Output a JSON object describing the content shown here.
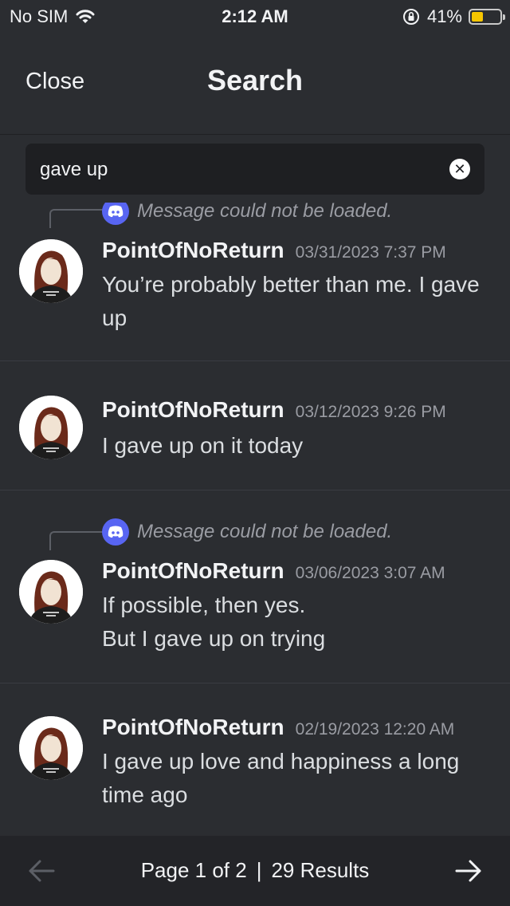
{
  "status_bar": {
    "carrier": "No SIM",
    "time": "2:12 AM",
    "battery_percent": "41%",
    "battery_level": 0.41,
    "icons": [
      "wifi-icon",
      "orientation-lock-icon",
      "battery-icon"
    ]
  },
  "header": {
    "close_label": "Close",
    "title": "Search"
  },
  "search": {
    "value": "gave up"
  },
  "results": [
    {
      "reply_text": "Message could not be loaded.",
      "username": "PointOfNoReturn",
      "timestamp": "03/31/2023 7:37 PM",
      "message": "You’re probably better than me. I gave up"
    },
    {
      "username": "PointOfNoReturn",
      "timestamp": "03/12/2023 9:26 PM",
      "message": "I gave up on it today"
    },
    {
      "reply_text": "Message could not be loaded.",
      "username": "PointOfNoReturn",
      "timestamp": "03/06/2023 3:07 AM",
      "message_lines": [
        "If possible, then yes.",
        "But I gave up on trying"
      ]
    },
    {
      "username": "PointOfNoReturn",
      "timestamp": "02/19/2023 12:20 AM",
      "message": "I gave up love and happiness a long time ago"
    }
  ],
  "footer": {
    "page_label": "Page 1 of 2",
    "separator": "|",
    "results_label": "29 Results"
  },
  "colors": {
    "background": "#2b2d31",
    "input_background": "#1e1f22",
    "footer_background": "#232428",
    "discord_blurple": "#5865f2",
    "battery_yellow": "#f7c600"
  }
}
